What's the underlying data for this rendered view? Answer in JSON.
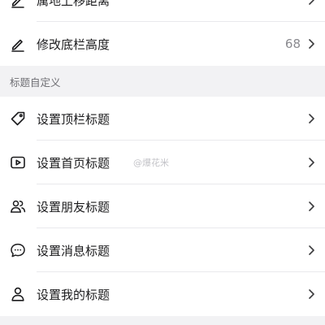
{
  "top_group": {
    "rows": [
      {
        "label": "属地上移距离",
        "value": "",
        "icon": "pencil-icon"
      },
      {
        "label": "修改底栏高度",
        "value": "68",
        "icon": "pencil-icon"
      }
    ]
  },
  "title_section": {
    "header": "标题自定义",
    "rows": [
      {
        "label": "设置顶栏标题",
        "icon": "tag-icon"
      },
      {
        "label": "设置首页标题",
        "icon": "play-square-icon"
      },
      {
        "label": "设置朋友标题",
        "icon": "friends-icon"
      },
      {
        "label": "设置消息标题",
        "icon": "message-bubble-icon"
      },
      {
        "label": "设置我的标题",
        "icon": "person-icon"
      }
    ]
  },
  "watermark": "@爆花米",
  "colors": {
    "background": "#f2f2f4",
    "row_bg": "#ffffff",
    "text": "#1c1c1e",
    "secondary_text": "#8a8a8f",
    "divider": "#e9e9ec"
  }
}
